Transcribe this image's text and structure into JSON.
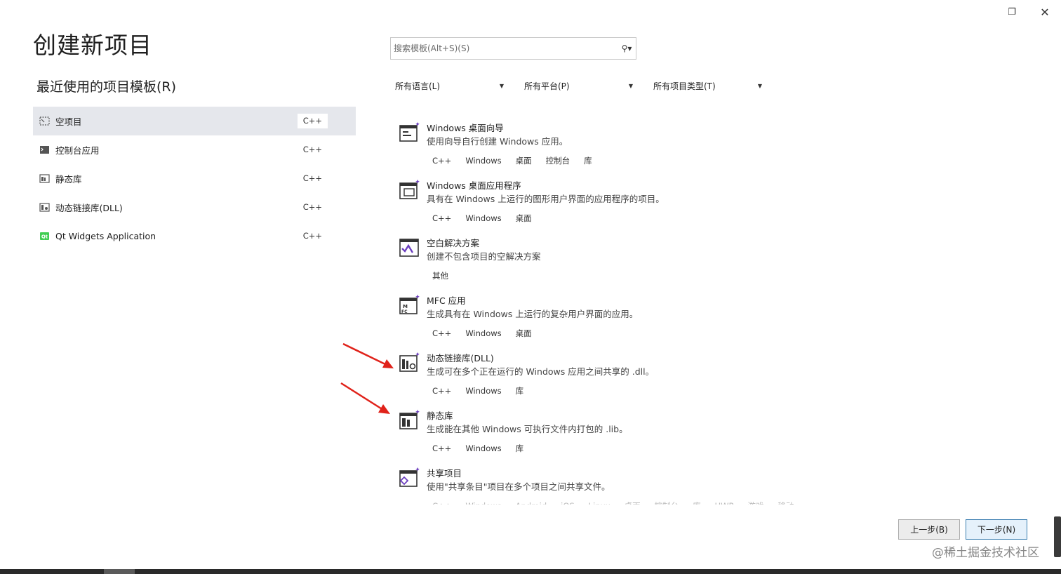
{
  "window": {
    "restore_icon": "restore-icon",
    "close_icon": "close-icon"
  },
  "title": "创建新项目",
  "recent": {
    "heading": "最近使用的项目模板(R)",
    "items": [
      {
        "label": "空项目",
        "lang": "C++",
        "icon": "empty-project-icon"
      },
      {
        "label": "控制台应用",
        "lang": "C++",
        "icon": "console-app-icon"
      },
      {
        "label": "静态库",
        "lang": "C++",
        "icon": "static-lib-icon"
      },
      {
        "label": "动态链接库(DLL)",
        "lang": "C++",
        "icon": "dll-icon"
      },
      {
        "label": "Qt Widgets Application",
        "lang": "C++",
        "icon": "qt-icon"
      }
    ]
  },
  "search": {
    "placeholder": "搜索模板(Alt+S)(S)",
    "icon": "search-icon"
  },
  "filters": {
    "language": "所有语言(L)",
    "platform": "所有平台(P)",
    "project_type": "所有项目类型(T)"
  },
  "templates": [
    {
      "name": "Windows 桌面向导",
      "desc": "使用向导自行创建 Windows 应用。",
      "tags": [
        "C++",
        "Windows",
        "桌面",
        "控制台",
        "库"
      ]
    },
    {
      "name": "Windows 桌面应用程序",
      "desc": "具有在 Windows 上运行的图形用户界面的应用程序的项目。",
      "tags": [
        "C++",
        "Windows",
        "桌面"
      ]
    },
    {
      "name": "空白解决方案",
      "desc": "创建不包含项目的空解决方案",
      "tags": [
        "其他"
      ]
    },
    {
      "name": "MFC 应用",
      "desc": "生成具有在 Windows 上运行的复杂用户界面的应用。",
      "tags": [
        "C++",
        "Windows",
        "桌面"
      ]
    },
    {
      "name": "动态链接库(DLL)",
      "desc": "生成可在多个正在运行的 Windows 应用之间共享的 .dll。",
      "tags": [
        "C++",
        "Windows",
        "库"
      ]
    },
    {
      "name": "静态库",
      "desc": "生成能在其他 Windows 可执行文件内打包的 .lib。",
      "tags": [
        "C++",
        "Windows",
        "库"
      ]
    },
    {
      "name": "共享项目",
      "desc": "使用\"共享条目\"项目在多个项目之间共享文件。",
      "tags": [
        "C++",
        "Windows",
        "Android",
        "iOS",
        "Linux",
        "桌面",
        "控制台",
        "库",
        "UWP",
        "游戏",
        "移动"
      ]
    }
  ],
  "buttons": {
    "prev": "上一步(B)",
    "next": "下一步(N)"
  },
  "watermark": "@稀土掘金技术社区",
  "colors": {
    "selected_bg": "#e5e7ec",
    "arrow": "#e0221a",
    "primary_border": "#3c7fb1"
  }
}
